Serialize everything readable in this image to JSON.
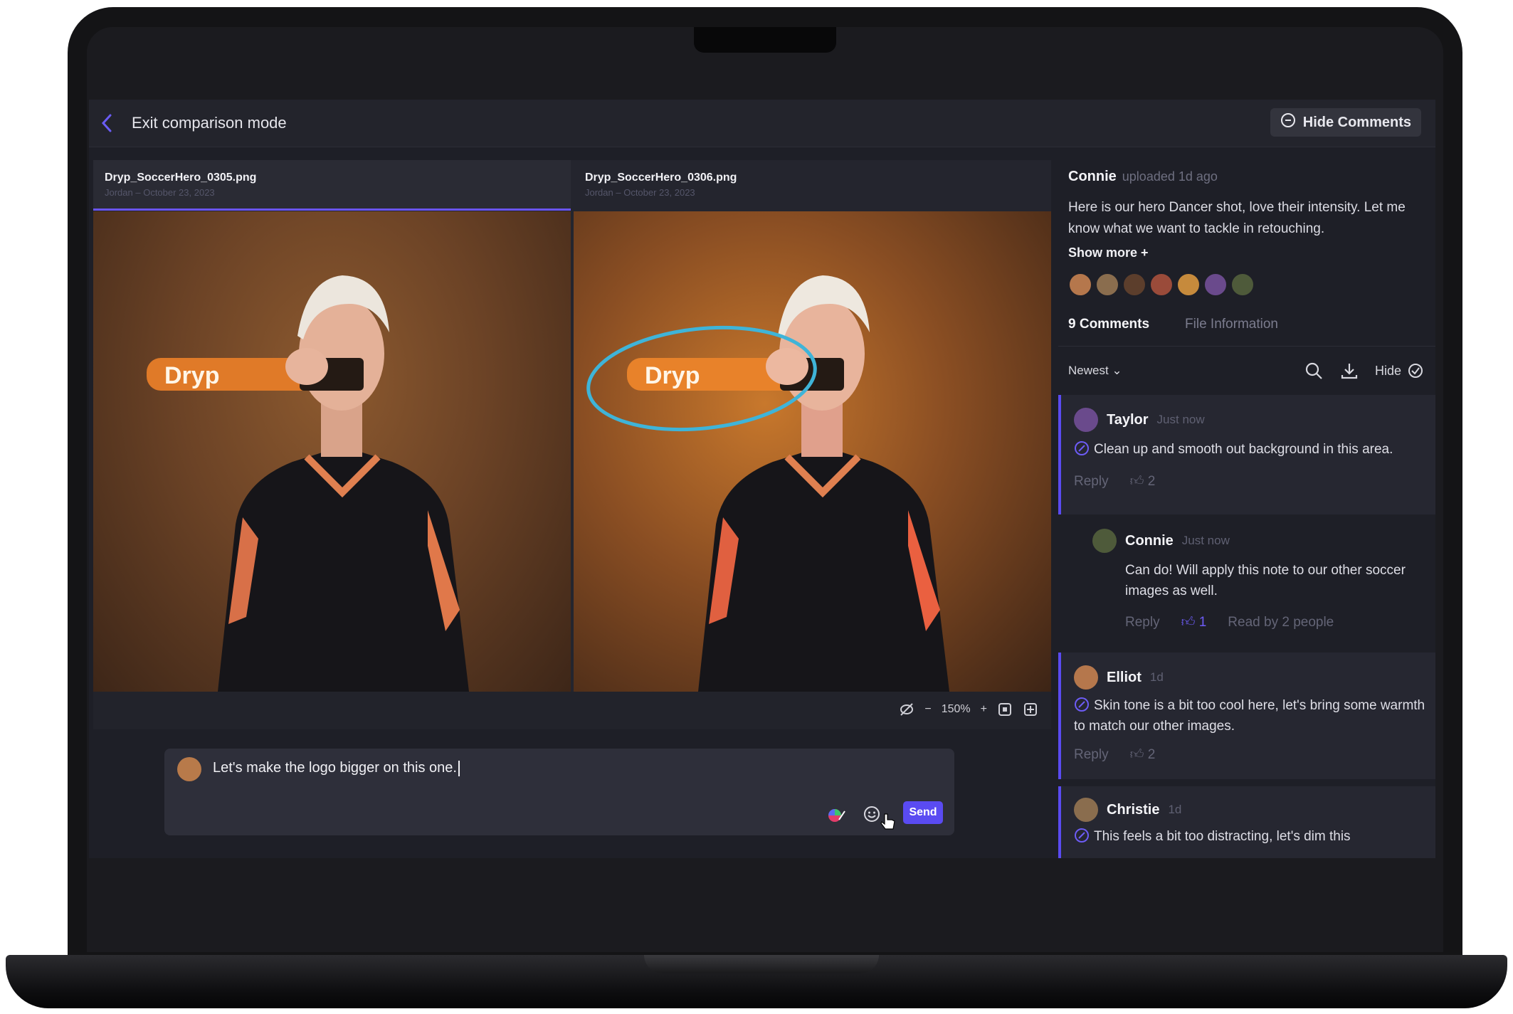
{
  "topbar": {
    "exit_label": "Exit comparison mode",
    "hide_comments": "Hide Comments"
  },
  "viewer": {
    "left": {
      "filename": "Dryp_SoccerHero_0305.png",
      "meta": "Jordan – October 23, 2023",
      "logo": "Dryp"
    },
    "right": {
      "filename": "Dryp_SoccerHero_0306.png",
      "meta": "Jordan – October 23, 2023",
      "logo": "Dryp"
    },
    "zoom": "150%"
  },
  "composer": {
    "text": "Let's make the logo bigger on this one.",
    "send": "Send"
  },
  "panel": {
    "uploader": "Connie",
    "uploaded": "uploaded 1d ago",
    "description": "Here is our hero Dancer shot, love their intensity. Let me know what we want to tackle in retouching.",
    "show_more": "Show more +",
    "tab_comments": "9 Comments",
    "tab_info": "File Information",
    "sort": "Newest",
    "hide": "Hide",
    "avatar_colors": [
      "#b5774c",
      "#8a6d4e",
      "#5c3e2c",
      "#9a4b3a",
      "#c68a3c",
      "#6a4a8c",
      "#4e5a3a"
    ]
  },
  "comments": [
    {
      "name": "Taylor",
      "time": "Just now",
      "text": "Clean up and smooth out background in this area.",
      "reply": "Reply",
      "likes": "2"
    },
    {
      "name": "Connie",
      "time": "Just now",
      "text": "Can do! Will apply this note to our other soccer images as well.",
      "reply": "Reply",
      "likes": "1",
      "read": "Read by 2 people"
    },
    {
      "name": "Elliot",
      "time": "1d",
      "text": "Skin tone is a bit too cool here, let's bring some warmth to match our other images.",
      "reply": "Reply",
      "likes": "2"
    },
    {
      "name": "Christie",
      "time": "1d",
      "text": "This feels a bit too distracting, let's dim this"
    }
  ],
  "colors": {
    "accent": "#5a4bf2",
    "annotation": "#3fb4d8"
  },
  "icons": [
    "back-chevron-icon",
    "comment-icon",
    "eye-off-icon",
    "fit-screen-icon",
    "fullscreen-icon",
    "search-icon",
    "download-icon",
    "check-circle-icon",
    "pin-icon",
    "thumbs-up-icon",
    "color-picker-icon",
    "emoji-icon",
    "pointer-cursor-icon"
  ]
}
